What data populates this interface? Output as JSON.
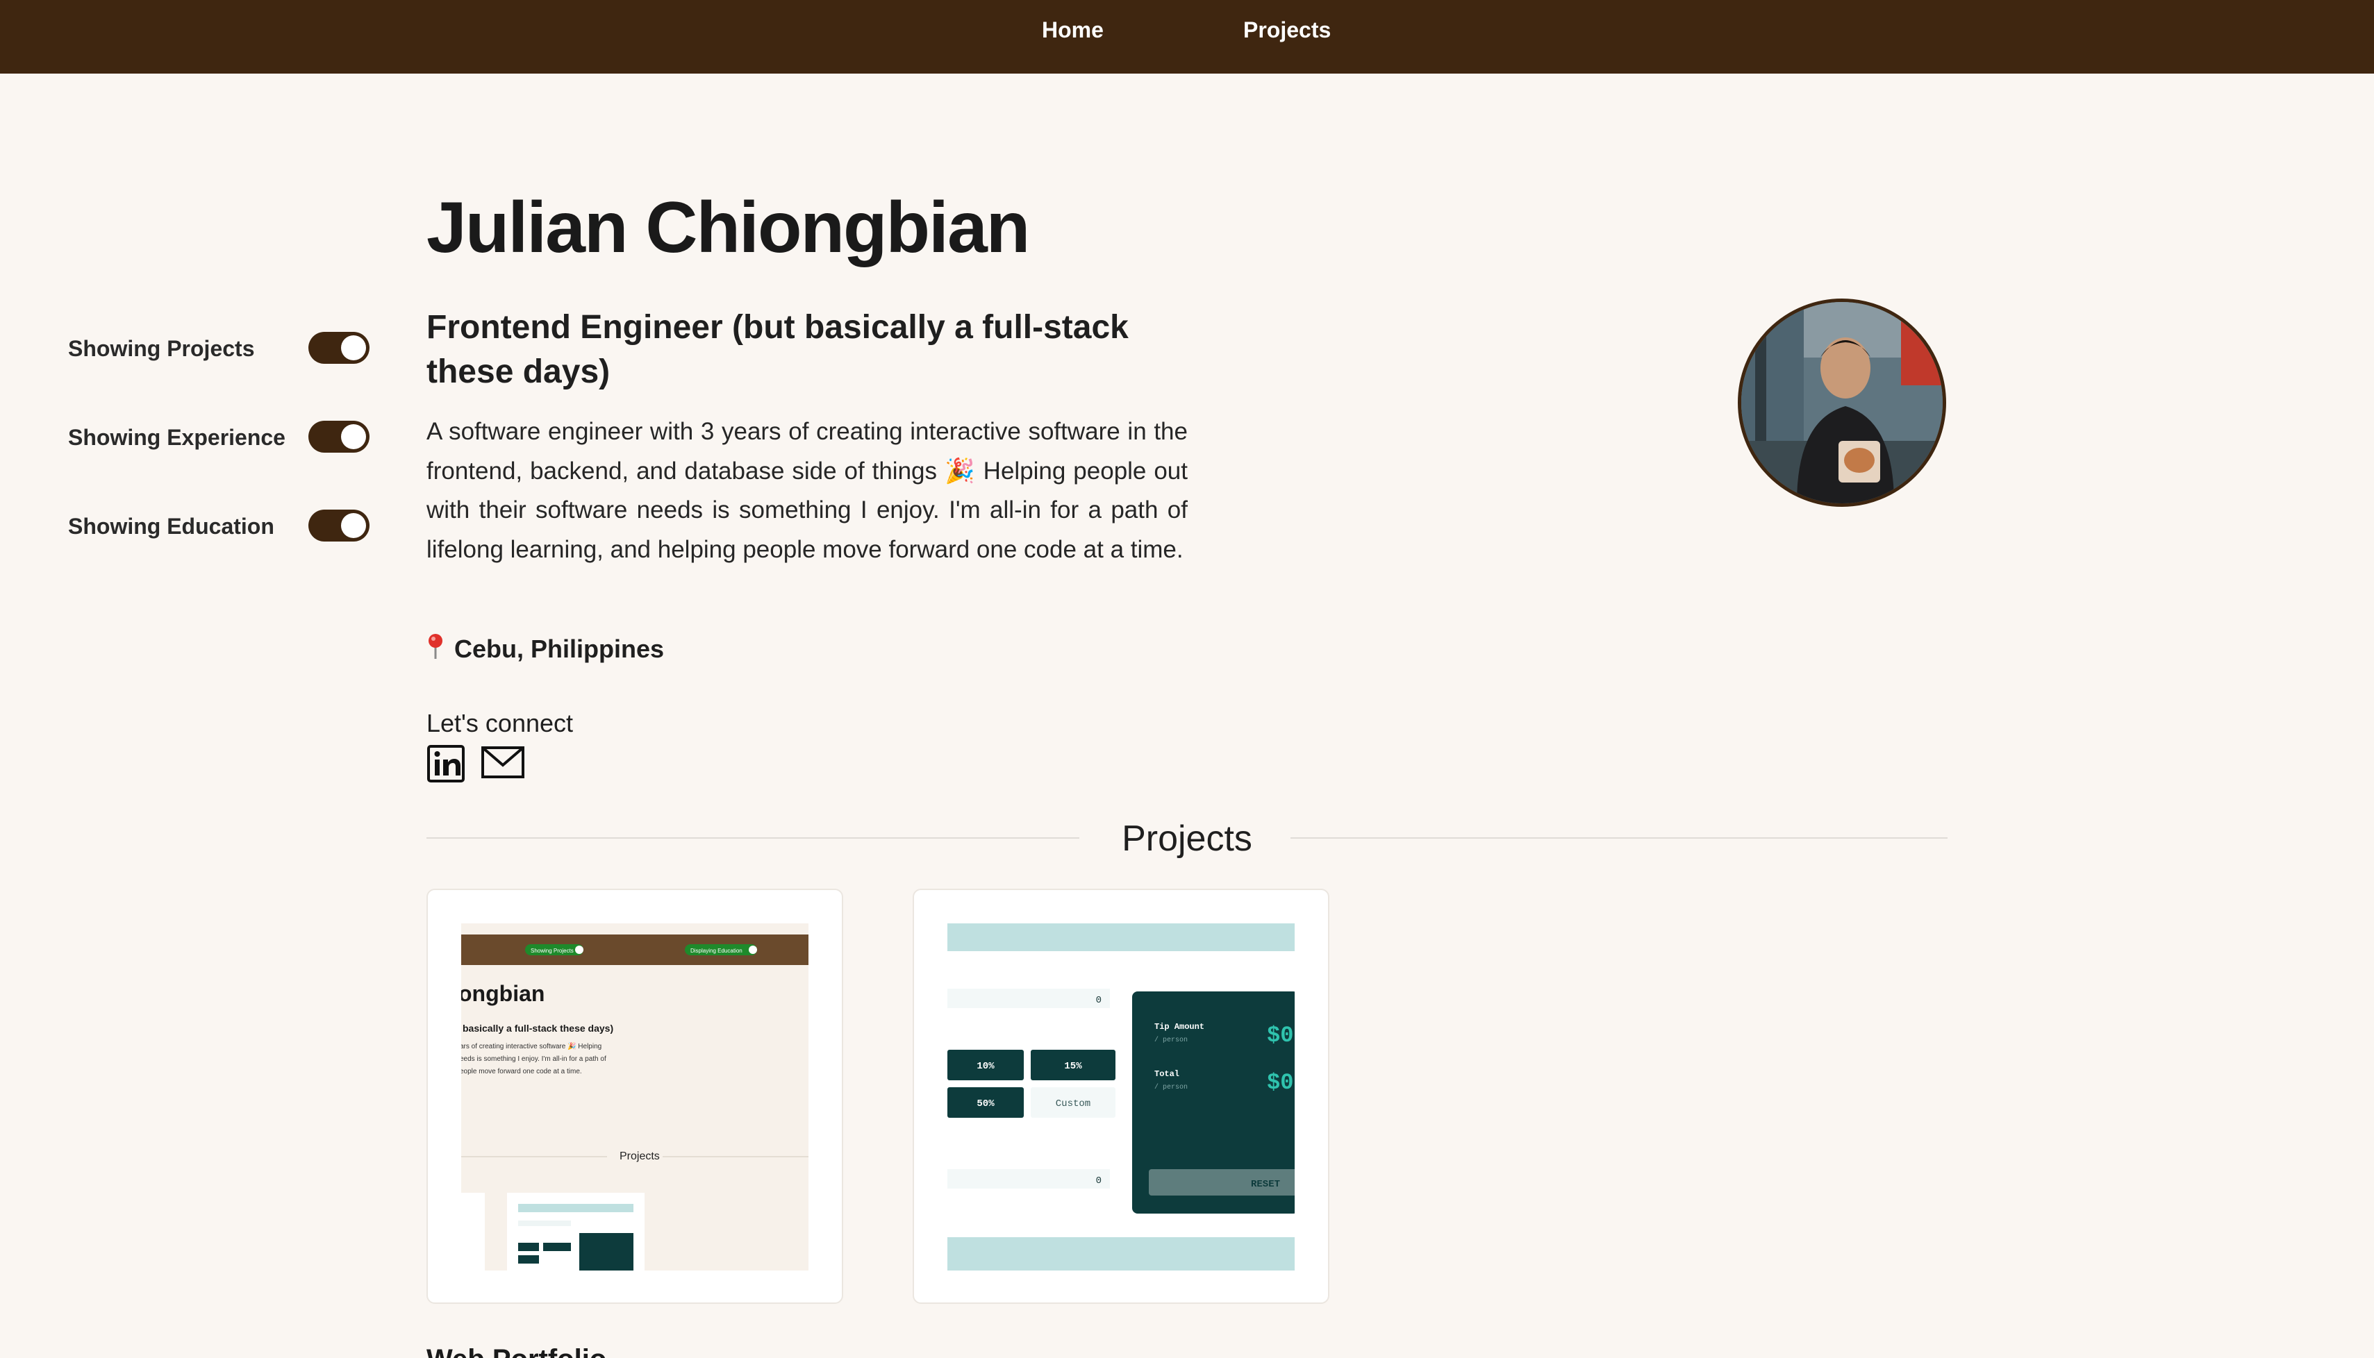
{
  "nav": {
    "home": "Home",
    "projects": "Projects"
  },
  "toggles": [
    {
      "label": "Showing Projects",
      "on": true
    },
    {
      "label": "Showing Experience",
      "on": true
    },
    {
      "label": "Showing Education",
      "on": true
    }
  ],
  "profile": {
    "name": "Julian Chiongbian",
    "role": "Frontend Engineer (but basically a full-stack these days)",
    "bio": "A software engineer with 3 years of creating interactive software in the frontend, backend, and database side of things 🎉 Helping people out with their software needs is something I enjoy. I'm all-in for a path of lifelong learning, and helping people move forward one code at a time.",
    "location": "Cebu, Philippines",
    "connect_label": "Let's connect",
    "social_icons": [
      "linkedin-icon",
      "mail-icon"
    ]
  },
  "projects": {
    "heading": "Projects",
    "cards": [
      {
        "thumb": {
          "switch_1": "Showing Projects",
          "switch_2": "Displaying Education",
          "name_fragment": "ongbian",
          "role_fragment": "basically a full-stack these days)",
          "bio_line_1": "ars of creating interactive software 🎉 Helping",
          "bio_line_2": "eeds is something I enjoy. I'm all-in for a path of",
          "bio_line_3": "eople move forward one code at a time.",
          "section": "Projects"
        }
      },
      {
        "thumb": {
          "bill_value": "0",
          "tips": [
            "10%",
            "15%",
            "50%"
          ],
          "custom_label": "Custom",
          "people_value": "0",
          "tip_amount_label": "Tip Amount",
          "per_person": "/ person",
          "total_label": "Total",
          "amount": "$0",
          "reset_label": "RESET"
        }
      }
    ],
    "next_heading": "Web Portfolio"
  },
  "colors": {
    "header": "#3f2610",
    "background": "#faf6f2",
    "toggle_on": "#3f2610",
    "calc_dark": "#0d3b3c",
    "calc_light": "#bfe0e0"
  }
}
